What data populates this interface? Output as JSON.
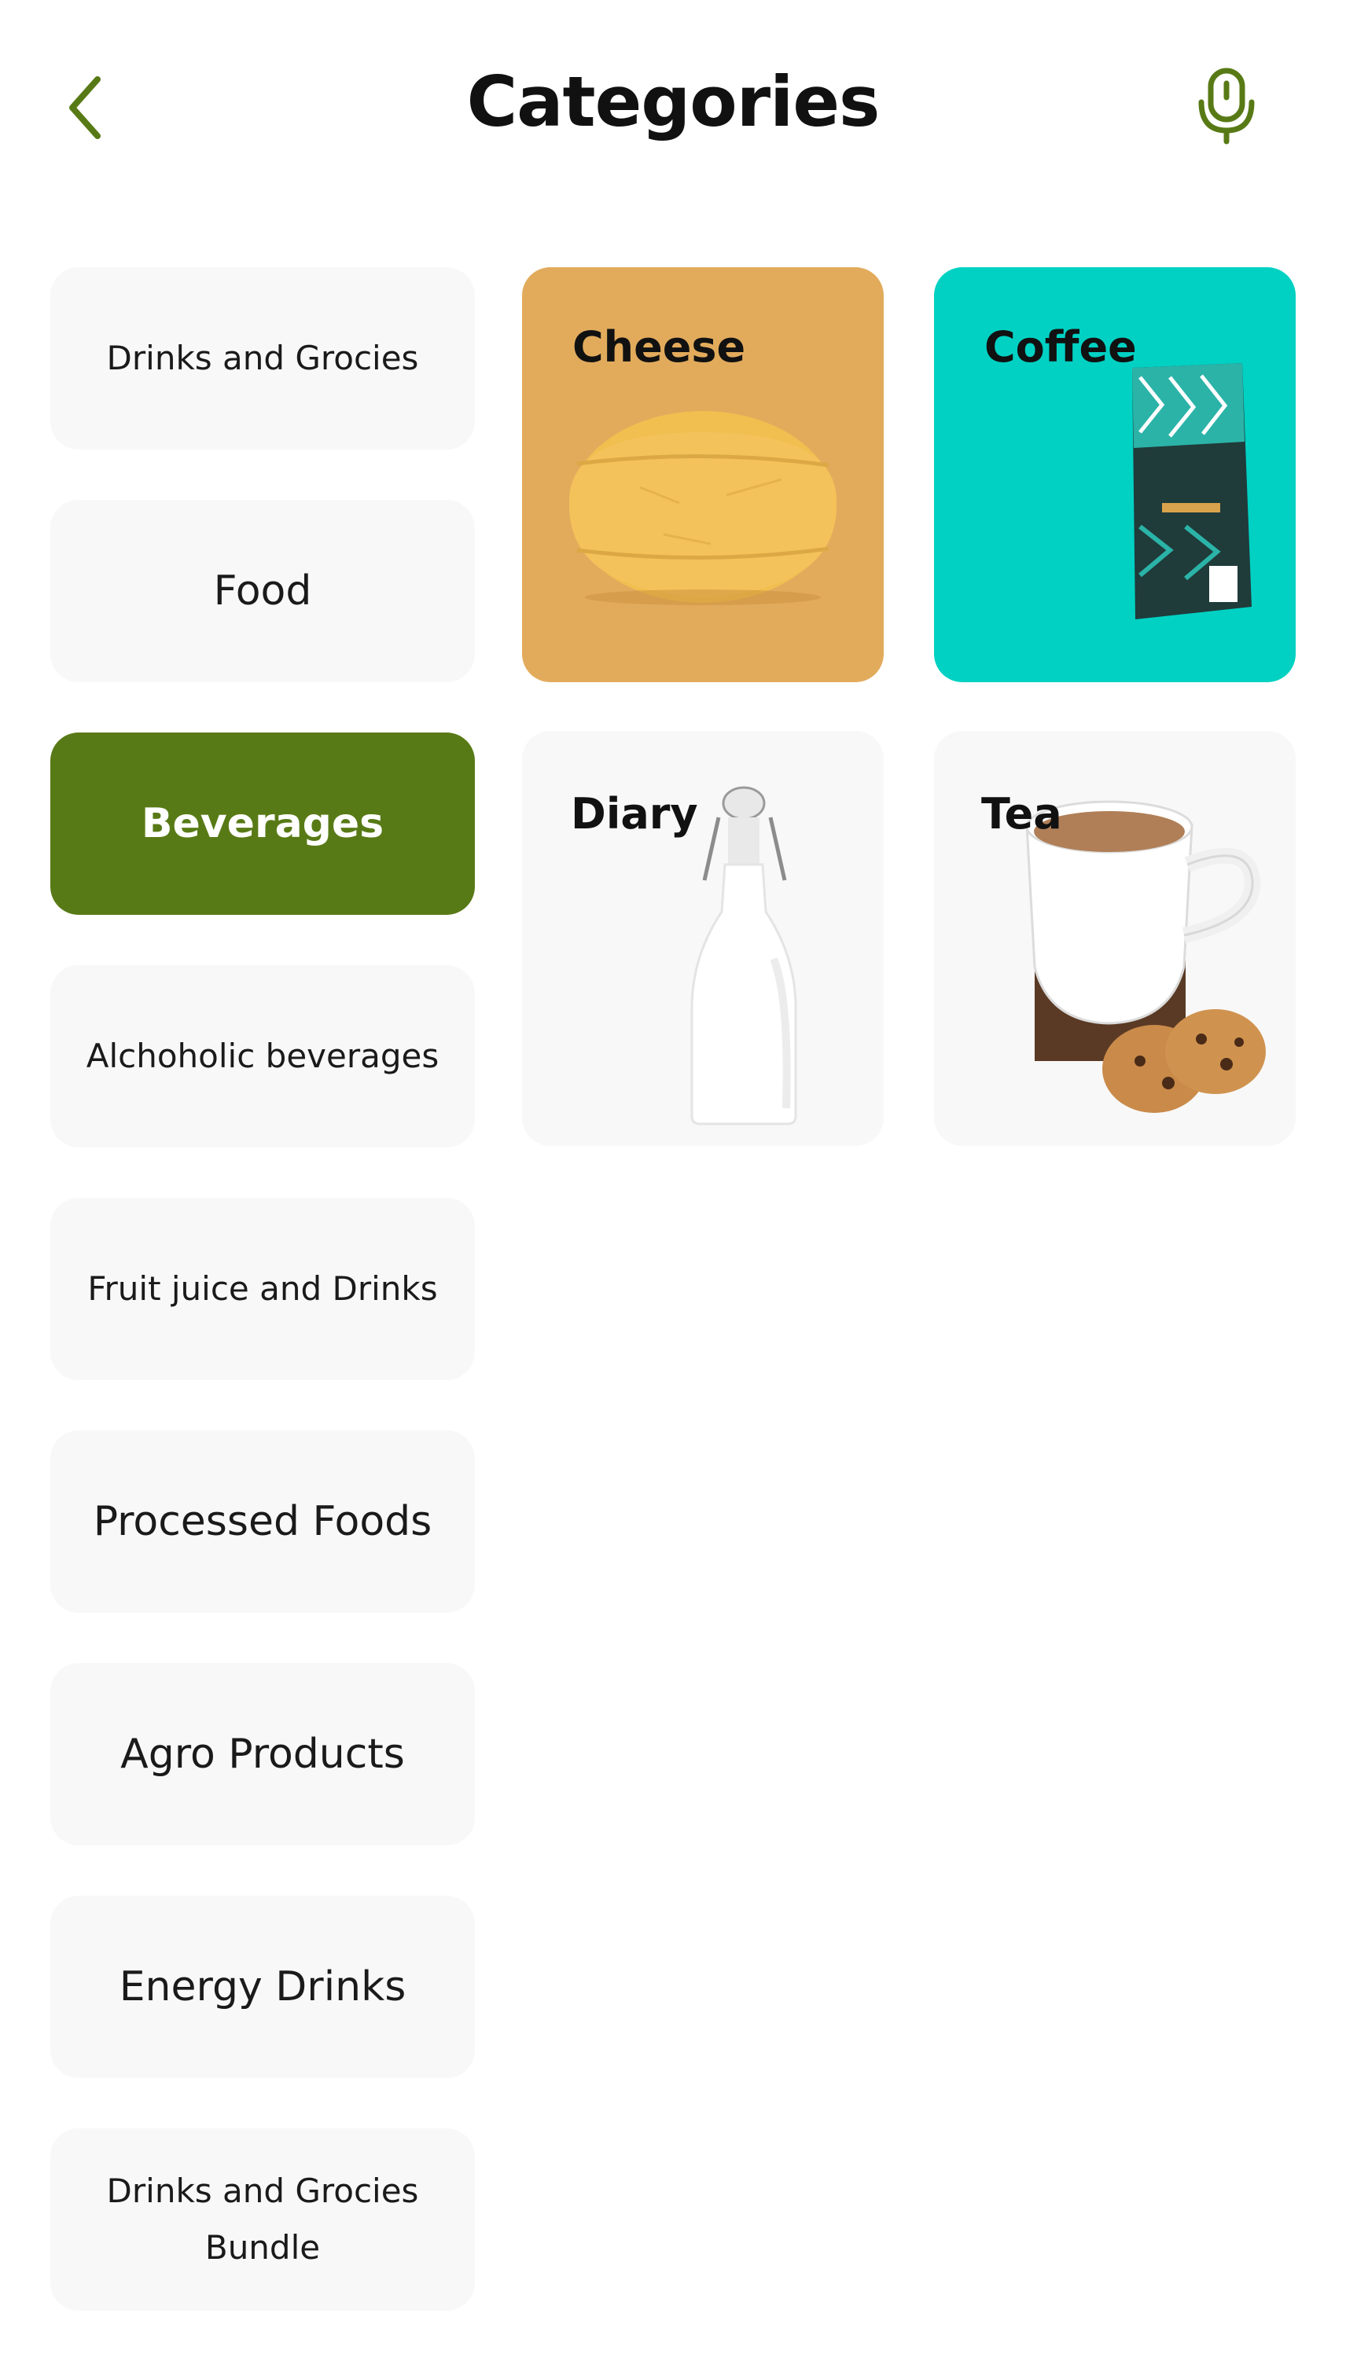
{
  "header": {
    "title": "Categories",
    "back_icon": "chevron-left-icon",
    "mic_icon": "microphone-icon",
    "accent_color": "#587a16"
  },
  "sidebar": {
    "items": [
      {
        "label": "Drinks and Grocies",
        "active": false
      },
      {
        "label": "Food",
        "active": false
      },
      {
        "label": "Beverages",
        "active": true
      },
      {
        "label": "Alchoholic beverages",
        "active": false
      },
      {
        "label": "Fruit juice and Drinks",
        "active": false
      },
      {
        "label": "Processed Foods",
        "active": false
      },
      {
        "label": "Agro Products",
        "active": false
      },
      {
        "label": "Energy Drinks",
        "active": false
      },
      {
        "label": "Drinks and Grocies Bundle",
        "active": false
      }
    ]
  },
  "cards": [
    {
      "label": "Cheese",
      "bg": "#e2ab5c"
    },
    {
      "label": "Coffee",
      "bg": "#00d1c3"
    },
    {
      "label": "Diary",
      "bg": "#f8f8f8"
    },
    {
      "label": "Tea",
      "bg": "#f8f8f8"
    }
  ]
}
